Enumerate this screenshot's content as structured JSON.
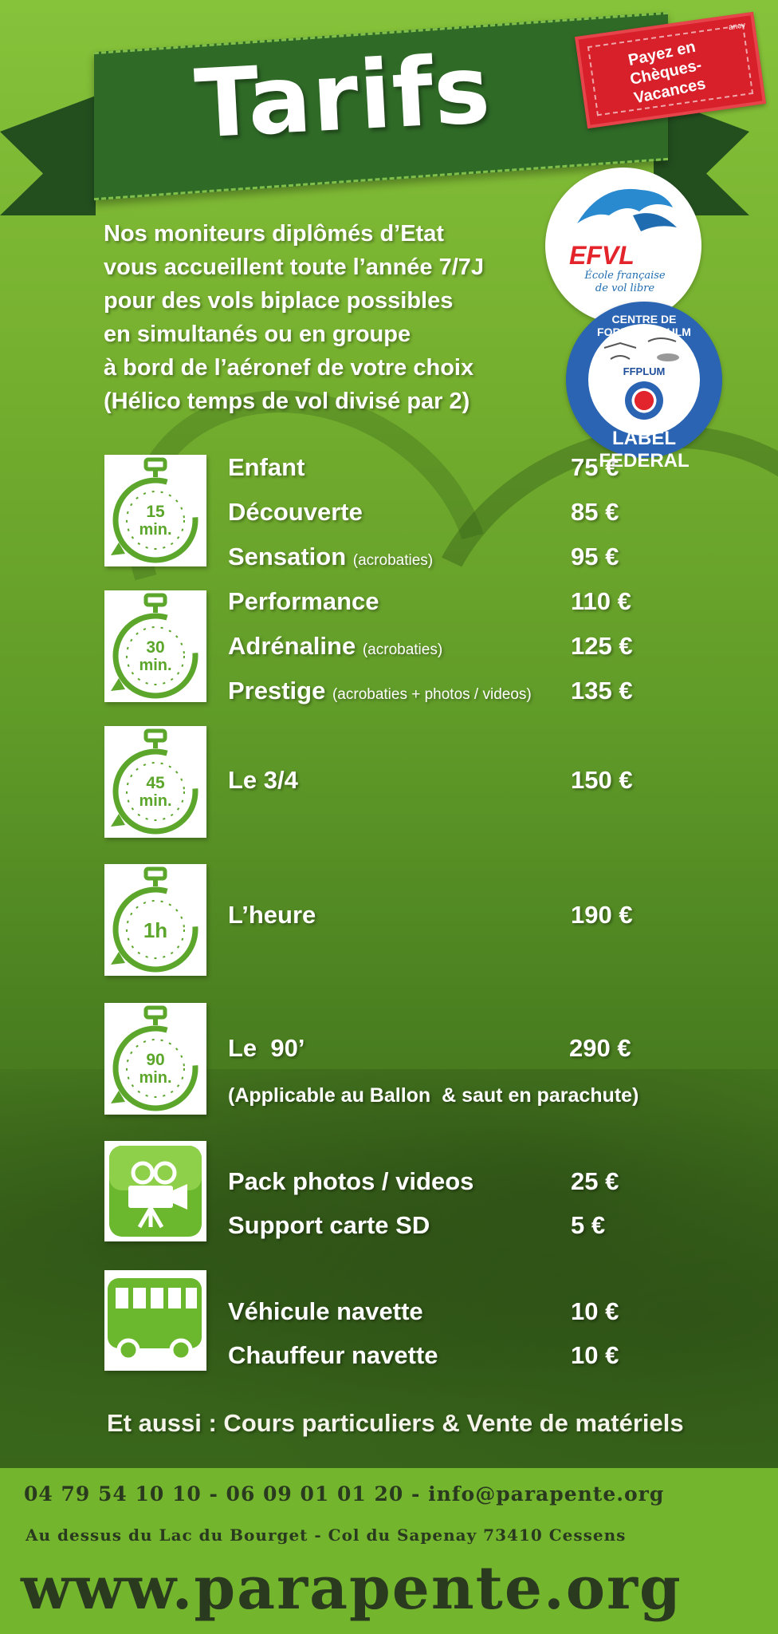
{
  "banner": {
    "title": "Tarifs"
  },
  "stamp": {
    "text_line1": "Payez en",
    "text_line2": "Chèques-Vacances",
    "brand": "ancv"
  },
  "intro": {
    "lines": [
      "Nos moniteurs diplômés d’Etat",
      "vous accueillent toute l’année 7/7J",
      "pour des vols biplace possibles",
      "en simultanés ou en groupe",
      "à bord de l’aéronef de votre choix",
      "(Hélico temps de vol divisé par 2)"
    ]
  },
  "logos": {
    "efvl": {
      "name": "EFVL",
      "subtitle_line1": "École française",
      "subtitle_line2": "de vol libre"
    },
    "ulm": {
      "top": "CENTRE DE FORMATION ULM",
      "bottom": "LABEL FEDERAL",
      "center": "FFPLUM"
    }
  },
  "groups": [
    {
      "icon": "stopwatch-icon",
      "icon_text_line1": "15",
      "icon_text_line2": "min.",
      "items": [
        {
          "label": "Enfant",
          "note": "",
          "price": "75 €"
        },
        {
          "label": "Découverte",
          "note": "",
          "price": "85 €"
        },
        {
          "label": "Sensation",
          "note": "(acrobaties)",
          "price": "95 €"
        }
      ]
    },
    {
      "icon": "stopwatch-icon",
      "icon_text_line1": "30",
      "icon_text_line2": "min.",
      "items": [
        {
          "label": "Performance",
          "note": "",
          "price": "110 €"
        },
        {
          "label": "Adrénaline",
          "note": "(acrobaties)",
          "price": "125 €"
        },
        {
          "label": "Prestige",
          "note": "(acrobaties + photos / videos)",
          "price": "135 €"
        }
      ]
    },
    {
      "icon": "stopwatch-icon",
      "icon_text_line1": "45",
      "icon_text_line2": "min.",
      "items": [
        {
          "label": "Le 3/4",
          "note": "",
          "price": "150 €"
        }
      ]
    },
    {
      "icon": "stopwatch-icon",
      "icon_text_line1": "1h",
      "icon_text_line2": "",
      "items": [
        {
          "label": "L’heure",
          "note": "",
          "price": "190 €"
        }
      ]
    },
    {
      "icon": "stopwatch-icon",
      "icon_text_line1": "90",
      "icon_text_line2": "min.",
      "items": [
        {
          "label": "Le  90’",
          "note": "",
          "price": "290 €"
        }
      ],
      "extra": "(Applicable au Ballon  & saut en parachute)"
    },
    {
      "icon": "video-camera-icon",
      "items": [
        {
          "label": "Pack photos / videos",
          "note": "",
          "price": "25 €"
        },
        {
          "label": "Support carte SD",
          "note": "",
          "price": "5 €"
        }
      ]
    },
    {
      "icon": "bus-icon",
      "items": [
        {
          "label": "Véhicule navette",
          "note": "",
          "price": "10 €"
        },
        {
          "label": "Chauffeur navette",
          "note": "",
          "price": "10 €"
        }
      ]
    }
  ],
  "aussi": "Et aussi : Cours particuliers & Vente de matériels",
  "footer": {
    "contact": "04 79 54 10 10 - 06 09 01 01 20 - info@parapente.org",
    "address": "Au dessus du Lac du Bourget - Col du Sapenay 73410 Cessens",
    "url": "www.parapente.org"
  },
  "colors": {
    "background_green": "#76b02f",
    "banner_green": "#2f6a27",
    "stamp_red": "#d7202a",
    "footer_green": "#74b52e",
    "icon_green": "#5ba62b"
  }
}
